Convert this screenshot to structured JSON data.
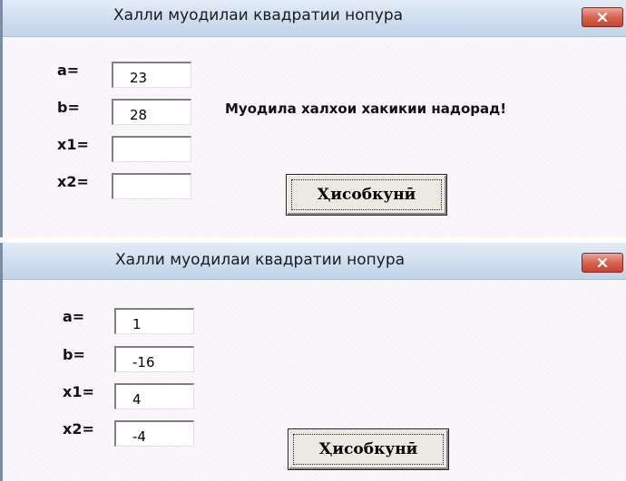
{
  "windows": [
    {
      "title": "Халли муодилаи квадратии нопура",
      "labels": {
        "a": "a=",
        "b": "b=",
        "x1": "x1=",
        "x2": "x2="
      },
      "fields": {
        "a": "23",
        "b": "28",
        "x1": "",
        "x2": ""
      },
      "message": "Муодила халхои хакикии надорад!",
      "button_label": "Ҳисобкунӣ"
    },
    {
      "title": "Халли муодилаи квадратии нопура",
      "labels": {
        "a": "a=",
        "b": "b=",
        "x1": "x1=",
        "x2": "x2="
      },
      "fields": {
        "a": "1",
        "b": "-16",
        "x1": "4",
        "x2": "-4"
      },
      "message": "",
      "button_label": "Ҳисобкунӣ"
    }
  ],
  "colors": {
    "close_button": "#d9644f",
    "titlebar": "#d2e0f0"
  },
  "icons": {
    "close": "close-icon"
  }
}
